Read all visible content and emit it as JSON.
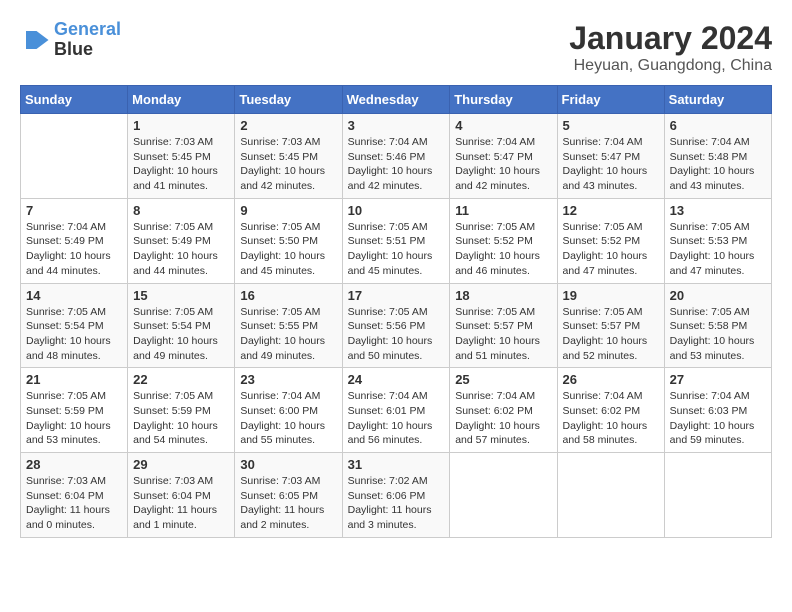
{
  "logo": {
    "line1": "General",
    "line2": "Blue"
  },
  "title": "January 2024",
  "location": "Heyuan, Guangdong, China",
  "days_header": [
    "Sunday",
    "Monday",
    "Tuesday",
    "Wednesday",
    "Thursday",
    "Friday",
    "Saturday"
  ],
  "weeks": [
    [
      {
        "day": "",
        "sunrise": "",
        "sunset": "",
        "daylight": ""
      },
      {
        "day": "1",
        "sunrise": "Sunrise: 7:03 AM",
        "sunset": "Sunset: 5:45 PM",
        "daylight": "Daylight: 10 hours and 41 minutes."
      },
      {
        "day": "2",
        "sunrise": "Sunrise: 7:03 AM",
        "sunset": "Sunset: 5:45 PM",
        "daylight": "Daylight: 10 hours and 42 minutes."
      },
      {
        "day": "3",
        "sunrise": "Sunrise: 7:04 AM",
        "sunset": "Sunset: 5:46 PM",
        "daylight": "Daylight: 10 hours and 42 minutes."
      },
      {
        "day": "4",
        "sunrise": "Sunrise: 7:04 AM",
        "sunset": "Sunset: 5:47 PM",
        "daylight": "Daylight: 10 hours and 42 minutes."
      },
      {
        "day": "5",
        "sunrise": "Sunrise: 7:04 AM",
        "sunset": "Sunset: 5:47 PM",
        "daylight": "Daylight: 10 hours and 43 minutes."
      },
      {
        "day": "6",
        "sunrise": "Sunrise: 7:04 AM",
        "sunset": "Sunset: 5:48 PM",
        "daylight": "Daylight: 10 hours and 43 minutes."
      }
    ],
    [
      {
        "day": "7",
        "sunrise": "Sunrise: 7:04 AM",
        "sunset": "Sunset: 5:49 PM",
        "daylight": "Daylight: 10 hours and 44 minutes."
      },
      {
        "day": "8",
        "sunrise": "Sunrise: 7:05 AM",
        "sunset": "Sunset: 5:49 PM",
        "daylight": "Daylight: 10 hours and 44 minutes."
      },
      {
        "day": "9",
        "sunrise": "Sunrise: 7:05 AM",
        "sunset": "Sunset: 5:50 PM",
        "daylight": "Daylight: 10 hours and 45 minutes."
      },
      {
        "day": "10",
        "sunrise": "Sunrise: 7:05 AM",
        "sunset": "Sunset: 5:51 PM",
        "daylight": "Daylight: 10 hours and 45 minutes."
      },
      {
        "day": "11",
        "sunrise": "Sunrise: 7:05 AM",
        "sunset": "Sunset: 5:52 PM",
        "daylight": "Daylight: 10 hours and 46 minutes."
      },
      {
        "day": "12",
        "sunrise": "Sunrise: 7:05 AM",
        "sunset": "Sunset: 5:52 PM",
        "daylight": "Daylight: 10 hours and 47 minutes."
      },
      {
        "day": "13",
        "sunrise": "Sunrise: 7:05 AM",
        "sunset": "Sunset: 5:53 PM",
        "daylight": "Daylight: 10 hours and 47 minutes."
      }
    ],
    [
      {
        "day": "14",
        "sunrise": "Sunrise: 7:05 AM",
        "sunset": "Sunset: 5:54 PM",
        "daylight": "Daylight: 10 hours and 48 minutes."
      },
      {
        "day": "15",
        "sunrise": "Sunrise: 7:05 AM",
        "sunset": "Sunset: 5:54 PM",
        "daylight": "Daylight: 10 hours and 49 minutes."
      },
      {
        "day": "16",
        "sunrise": "Sunrise: 7:05 AM",
        "sunset": "Sunset: 5:55 PM",
        "daylight": "Daylight: 10 hours and 49 minutes."
      },
      {
        "day": "17",
        "sunrise": "Sunrise: 7:05 AM",
        "sunset": "Sunset: 5:56 PM",
        "daylight": "Daylight: 10 hours and 50 minutes."
      },
      {
        "day": "18",
        "sunrise": "Sunrise: 7:05 AM",
        "sunset": "Sunset: 5:57 PM",
        "daylight": "Daylight: 10 hours and 51 minutes."
      },
      {
        "day": "19",
        "sunrise": "Sunrise: 7:05 AM",
        "sunset": "Sunset: 5:57 PM",
        "daylight": "Daylight: 10 hours and 52 minutes."
      },
      {
        "day": "20",
        "sunrise": "Sunrise: 7:05 AM",
        "sunset": "Sunset: 5:58 PM",
        "daylight": "Daylight: 10 hours and 53 minutes."
      }
    ],
    [
      {
        "day": "21",
        "sunrise": "Sunrise: 7:05 AM",
        "sunset": "Sunset: 5:59 PM",
        "daylight": "Daylight: 10 hours and 53 minutes."
      },
      {
        "day": "22",
        "sunrise": "Sunrise: 7:05 AM",
        "sunset": "Sunset: 5:59 PM",
        "daylight": "Daylight: 10 hours and 54 minutes."
      },
      {
        "day": "23",
        "sunrise": "Sunrise: 7:04 AM",
        "sunset": "Sunset: 6:00 PM",
        "daylight": "Daylight: 10 hours and 55 minutes."
      },
      {
        "day": "24",
        "sunrise": "Sunrise: 7:04 AM",
        "sunset": "Sunset: 6:01 PM",
        "daylight": "Daylight: 10 hours and 56 minutes."
      },
      {
        "day": "25",
        "sunrise": "Sunrise: 7:04 AM",
        "sunset": "Sunset: 6:02 PM",
        "daylight": "Daylight: 10 hours and 57 minutes."
      },
      {
        "day": "26",
        "sunrise": "Sunrise: 7:04 AM",
        "sunset": "Sunset: 6:02 PM",
        "daylight": "Daylight: 10 hours and 58 minutes."
      },
      {
        "day": "27",
        "sunrise": "Sunrise: 7:04 AM",
        "sunset": "Sunset: 6:03 PM",
        "daylight": "Daylight: 10 hours and 59 minutes."
      }
    ],
    [
      {
        "day": "28",
        "sunrise": "Sunrise: 7:03 AM",
        "sunset": "Sunset: 6:04 PM",
        "daylight": "Daylight: 11 hours and 0 minutes."
      },
      {
        "day": "29",
        "sunrise": "Sunrise: 7:03 AM",
        "sunset": "Sunset: 6:04 PM",
        "daylight": "Daylight: 11 hours and 1 minute."
      },
      {
        "day": "30",
        "sunrise": "Sunrise: 7:03 AM",
        "sunset": "Sunset: 6:05 PM",
        "daylight": "Daylight: 11 hours and 2 minutes."
      },
      {
        "day": "31",
        "sunrise": "Sunrise: 7:02 AM",
        "sunset": "Sunset: 6:06 PM",
        "daylight": "Daylight: 11 hours and 3 minutes."
      },
      {
        "day": "",
        "sunrise": "",
        "sunset": "",
        "daylight": ""
      },
      {
        "day": "",
        "sunrise": "",
        "sunset": "",
        "daylight": ""
      },
      {
        "day": "",
        "sunrise": "",
        "sunset": "",
        "daylight": ""
      }
    ]
  ]
}
